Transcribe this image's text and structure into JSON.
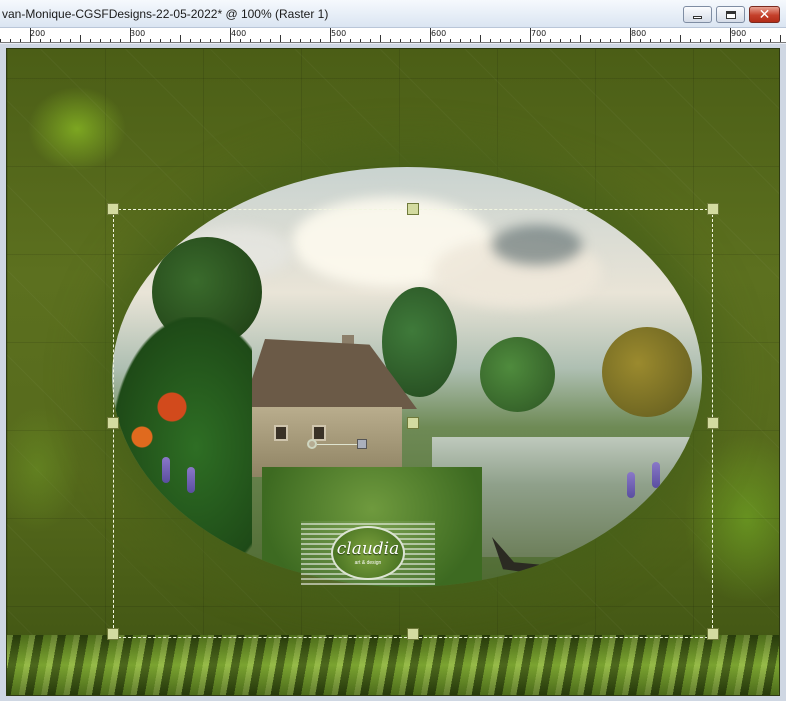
{
  "window": {
    "title": "van-Monique-CGSFDesigns-22-05-2022* @ 100% (Raster 1)",
    "buttons": {
      "minimize": "minimize",
      "maximize": "maximize",
      "close": "close"
    }
  },
  "ruler": {
    "labels": [
      "200",
      "300",
      "400",
      "500",
      "600",
      "700",
      "800",
      "900"
    ]
  },
  "watermark": {
    "name": "claudia",
    "tagline": "art & design"
  },
  "colors": {
    "canvas_green": "#566a1c",
    "handle_fill": "#d3dba0",
    "titlebar": "#dbe5f2",
    "close_red": "#c4402b"
  }
}
